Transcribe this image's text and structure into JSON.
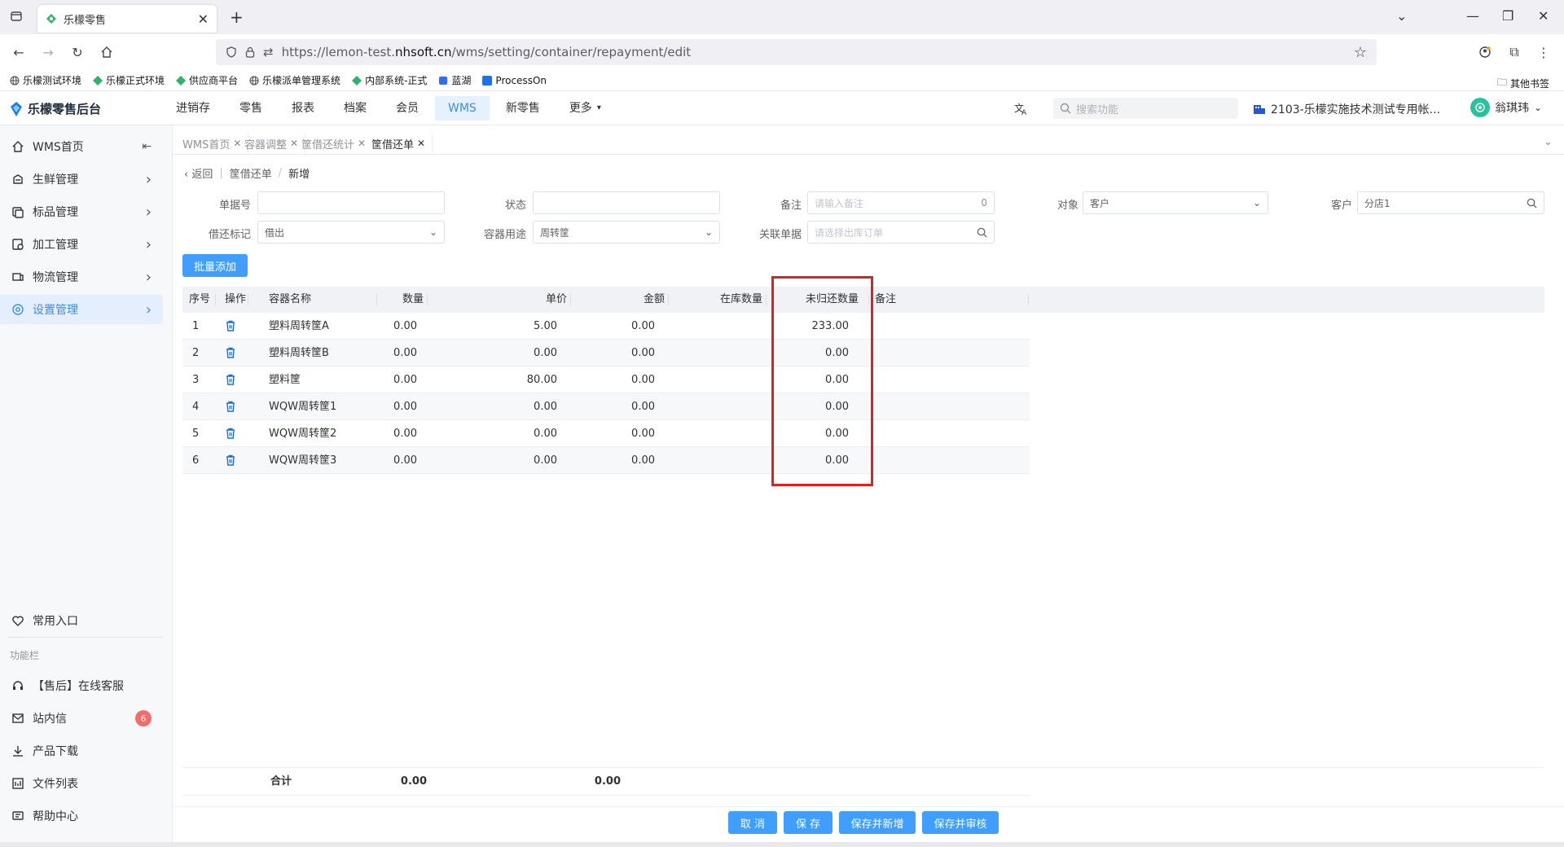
{
  "browser": {
    "tab_title": "乐檬零售",
    "url_prefix": "https://lemon-test.",
    "url_host": "nhsoft.cn",
    "url_path": "/wms/setting/container/repayment/edit",
    "bookmarks": [
      "乐檬测试环境",
      "乐檬正式环境",
      "供应商平台",
      "乐檬派单管理系统",
      "内部系统-正式",
      "蓝湖",
      "ProcessOn"
    ],
    "other_bookmarks": "其他书签"
  },
  "app": {
    "logo_text": "乐檬零售后台",
    "top_menu": [
      {
        "label": "进销存",
        "active": false
      },
      {
        "label": "零售",
        "active": false
      },
      {
        "label": "报表",
        "active": false
      },
      {
        "label": "档案",
        "active": false
      },
      {
        "label": "会员",
        "active": false
      },
      {
        "label": "WMS",
        "active": true
      },
      {
        "label": "新零售",
        "active": false
      },
      {
        "label": "更多",
        "active": false
      }
    ],
    "search_placeholder": "搜索功能",
    "org_name": "2103-乐檬实施技术测试专用帐...",
    "user_name": "翁琪玮"
  },
  "sidebar": {
    "items": [
      {
        "label": "WMS首页",
        "icon": "home-icon"
      },
      {
        "label": "生鲜管理",
        "icon": "fresh-icon"
      },
      {
        "label": "标品管理",
        "icon": "product-icon"
      },
      {
        "label": "加工管理",
        "icon": "process-icon"
      },
      {
        "label": "物流管理",
        "icon": "logistics-icon"
      },
      {
        "label": "设置管理",
        "icon": "settings-icon"
      }
    ],
    "favorites": "常用入口",
    "section_title": "功能栏",
    "tools": [
      {
        "label": "【售后】在线客服",
        "icon": "headset-icon"
      },
      {
        "label": "站内信",
        "icon": "mail-icon",
        "badge": "6"
      },
      {
        "label": "产品下载",
        "icon": "download-icon"
      },
      {
        "label": "文件列表",
        "icon": "file-list-icon"
      },
      {
        "label": "帮助中心",
        "icon": "help-icon"
      }
    ]
  },
  "page_tabs": [
    {
      "label": "WMS首页",
      "active": false
    },
    {
      "label": "容器调整",
      "active": false
    },
    {
      "label": "筐借还统计",
      "active": false
    },
    {
      "label": "筐借还单",
      "active": true
    }
  ],
  "breadcrumb": {
    "back": "返回",
    "parent": "筐借还单",
    "sep": "/",
    "current": "新增"
  },
  "form": {
    "order_no": {
      "label": "单据号",
      "value": ""
    },
    "status": {
      "label": "状态",
      "value": ""
    },
    "remark": {
      "label": "备注",
      "placeholder": "请输入备注",
      "count": "0"
    },
    "target": {
      "label": "对象",
      "value": "客户"
    },
    "customer": {
      "label": "客户",
      "value": "分店1"
    },
    "borrow_flag": {
      "label": "借还标记",
      "value": "借出"
    },
    "container_use": {
      "label": "容器用途",
      "value": "周转筐"
    },
    "related_doc": {
      "label": "关联单据",
      "placeholder": "请选择出库订单"
    }
  },
  "batch_add_label": "批量添加",
  "table": {
    "headers": [
      "序号",
      "操作",
      "容器名称",
      "数量",
      "单价",
      "金额",
      "在库数量",
      "未归还数量",
      "备注"
    ],
    "rows": [
      {
        "no": "1",
        "name": "塑料周转筐A",
        "qty": "0.00",
        "price": "5.00",
        "amount": "0.00",
        "unreturned": "233.00"
      },
      {
        "no": "2",
        "name": "塑料周转筐B",
        "qty": "0.00",
        "price": "0.00",
        "amount": "0.00",
        "unreturned": "0.00"
      },
      {
        "no": "3",
        "name": "塑料筐",
        "qty": "0.00",
        "price": "80.00",
        "amount": "0.00",
        "unreturned": "0.00"
      },
      {
        "no": "4",
        "name": "WQW周转筐1",
        "qty": "0.00",
        "price": "0.00",
        "amount": "0.00",
        "unreturned": "0.00"
      },
      {
        "no": "5",
        "name": "WQW周转筐2",
        "qty": "0.00",
        "price": "0.00",
        "amount": "0.00",
        "unreturned": "0.00"
      },
      {
        "no": "6",
        "name": "WQW周转筐3",
        "qty": "0.00",
        "price": "0.00",
        "amount": "0.00",
        "unreturned": "0.00"
      }
    ],
    "footer": {
      "label": "合计",
      "qty": "0.00",
      "amount": "0.00"
    }
  },
  "actions": {
    "cancel": "取 消",
    "save": "保 存",
    "save_new": "保存并新增",
    "save_audit": "保存并审核"
  },
  "colors": {
    "accent": "#409eff",
    "highlight": "#e0201f",
    "badge": "#f56c6c"
  }
}
